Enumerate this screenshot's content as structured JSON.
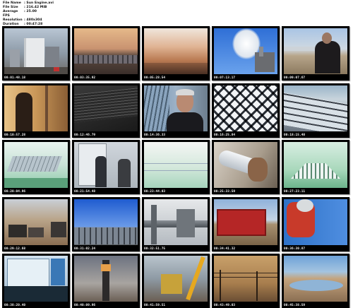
{
  "meta": {
    "labels": [
      "File Name",
      "File Size",
      "Average FPS",
      "Resolution",
      "Duration"
    ],
    "values": [
      ": Sun Engine.avi",
      ": 216.42 MiB",
      ": 25.00",
      ": 480x304",
      ": 00:47:28"
    ]
  },
  "thumbnails": [
    {
      "ts": "00:01:48.18",
      "scene": "city-buildings"
    },
    {
      "ts": "00:03:35.92",
      "scene": "desert-solar-field"
    },
    {
      "ts": "00:05:28.54",
      "scene": "hazy-sunrise"
    },
    {
      "ts": "00:07:13.17",
      "scene": "power-plant-steam"
    },
    {
      "ts": "00:09:07.67",
      "scene": "man-in-desert"
    },
    {
      "ts": "00:10:57.28",
      "scene": "worker-silhouette"
    },
    {
      "ts": "00:12:46.79",
      "scene": "dark-panel-closeup"
    },
    {
      "ts": "00:14:36.33",
      "scene": "interview-man"
    },
    {
      "ts": "00:16:25.84",
      "scene": "heliostat-array"
    },
    {
      "ts": "00:18:15.40",
      "scene": "trough-mirrors"
    },
    {
      "ts": "00:20:04.96",
      "scene": "3d-trough-render"
    },
    {
      "ts": "00:21:54.48",
      "scene": "people-at-mirror"
    },
    {
      "ts": "00:23:44.03",
      "scene": "green-sky-render"
    },
    {
      "ts": "00:25:33.59",
      "scene": "hand-tube"
    },
    {
      "ts": "00:27:23.11",
      "scene": "3d-fresnel-render"
    },
    {
      "ts": "00:29:12.68",
      "scene": "trucks-desert"
    },
    {
      "ts": "00:31:02.24",
      "scene": "blue-sky-field"
    },
    {
      "ts": "00:32:51.75",
      "scene": "industrial-pipes"
    },
    {
      "ts": "00:34:41.32",
      "scene": "red-building"
    },
    {
      "ts": "00:36:30.87",
      "scene": "red-machine"
    },
    {
      "ts": "00:38:20.40",
      "scene": "control-panel"
    },
    {
      "ts": "00:40:09.96",
      "scene": "solar-tower"
    },
    {
      "ts": "00:41:59.51",
      "scene": "construction-crane"
    },
    {
      "ts": "00:43:49.03",
      "scene": "desert-wires"
    },
    {
      "ts": "00:45:38.59",
      "scene": "lake-hills"
    }
  ]
}
